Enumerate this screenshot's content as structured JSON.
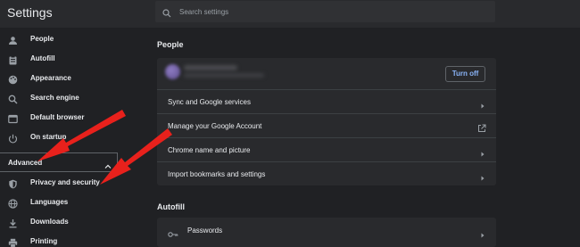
{
  "app": {
    "title": "Settings"
  },
  "search": {
    "placeholder": "Search settings"
  },
  "sidebar": {
    "items": [
      {
        "label": "People",
        "icon": "person-icon"
      },
      {
        "label": "Autofill",
        "icon": "clipboard-icon"
      },
      {
        "label": "Appearance",
        "icon": "palette-icon"
      },
      {
        "label": "Search engine",
        "icon": "search-icon"
      },
      {
        "label": "Default browser",
        "icon": "browser-icon"
      },
      {
        "label": "On startup",
        "icon": "power-icon"
      }
    ],
    "advanced_label": "Advanced",
    "advanced_items": [
      {
        "label": "Privacy and security",
        "icon": "shield-icon"
      },
      {
        "label": "Languages",
        "icon": "globe-icon"
      },
      {
        "label": "Downloads",
        "icon": "download-icon"
      },
      {
        "label": "Printing",
        "icon": "printer-icon"
      }
    ]
  },
  "people": {
    "title": "People",
    "turn_off_label": "Turn off",
    "rows": [
      {
        "label": "Sync and Google services"
      },
      {
        "label": "Manage your Google Account"
      },
      {
        "label": "Chrome name and picture"
      },
      {
        "label": "Import bookmarks and settings"
      }
    ]
  },
  "autofill": {
    "title": "Autofill",
    "rows": [
      {
        "label": "Passwords"
      }
    ]
  },
  "colors": {
    "background": "#202124",
    "card": "#292a2d",
    "accent": "#8ab4f8",
    "annotation": "#e8211c"
  }
}
